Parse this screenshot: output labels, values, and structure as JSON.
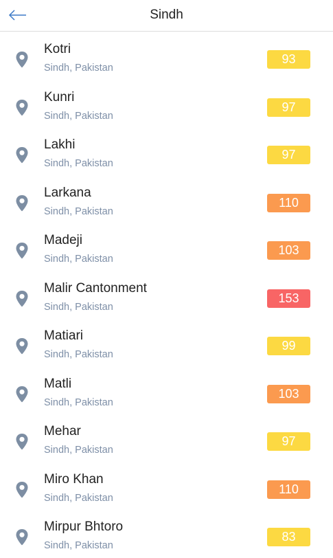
{
  "header": {
    "title": "Sindh",
    "back_icon": "arrow-left-icon"
  },
  "colors": {
    "moderate": "#fcd942",
    "unhealthy_sensitive": "#fb9a4f",
    "unhealthy": "#f86565",
    "pin": "#7d8ea3"
  },
  "locations": [
    {
      "name": "Kotri",
      "region": "Sindh, Pakistan",
      "aqi": "93",
      "level": "moderate"
    },
    {
      "name": "Kunri",
      "region": "Sindh, Pakistan",
      "aqi": "97",
      "level": "moderate"
    },
    {
      "name": "Lakhi",
      "region": "Sindh, Pakistan",
      "aqi": "97",
      "level": "moderate"
    },
    {
      "name": "Larkana",
      "region": "Sindh, Pakistan",
      "aqi": "110",
      "level": "unhealthy_sensitive"
    },
    {
      "name": "Madeji",
      "region": "Sindh, Pakistan",
      "aqi": "103",
      "level": "unhealthy_sensitive"
    },
    {
      "name": "Malir Cantonment",
      "region": "Sindh, Pakistan",
      "aqi": "153",
      "level": "unhealthy"
    },
    {
      "name": "Matiari",
      "region": "Sindh, Pakistan",
      "aqi": "99",
      "level": "moderate"
    },
    {
      "name": "Matli",
      "region": "Sindh, Pakistan",
      "aqi": "103",
      "level": "unhealthy_sensitive"
    },
    {
      "name": "Mehar",
      "region": "Sindh, Pakistan",
      "aqi": "97",
      "level": "moderate"
    },
    {
      "name": "Miro Khan",
      "region": "Sindh, Pakistan",
      "aqi": "110",
      "level": "unhealthy_sensitive"
    },
    {
      "name": "Mirpur Bhtoro",
      "region": "Sindh, Pakistan",
      "aqi": "83",
      "level": "moderate"
    }
  ]
}
